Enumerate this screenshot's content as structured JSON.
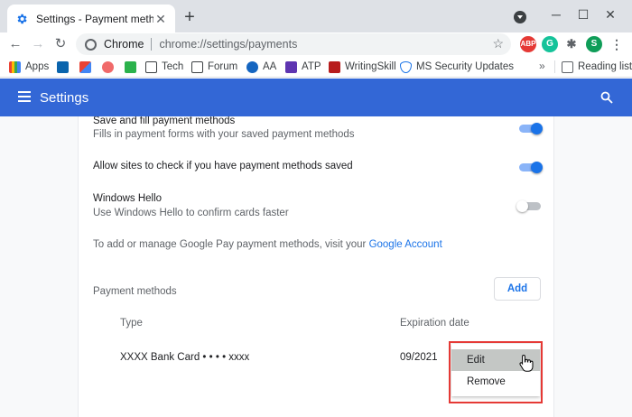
{
  "tab": {
    "title": "Settings - Payment methods",
    "close": "✕"
  },
  "window": {
    "new_tab": "+",
    "minimize": "─",
    "maximize": "☐",
    "close": "✕"
  },
  "toolbar": {
    "site_label": "Chrome",
    "url": "chrome://settings/payments",
    "extensions": [
      {
        "label": "ABP",
        "color": "#e53935"
      },
      {
        "label": "G",
        "color": "#15c39a"
      },
      {
        "label": "S",
        "color": "#0f9d58"
      }
    ]
  },
  "bookmarks": {
    "items": [
      "Apps",
      "",
      "",
      "",
      "",
      "Tech",
      "Forum",
      "AA",
      "ATP",
      "WritingSkill",
      "MS Security Updates"
    ],
    "chevron": "»",
    "reading_list": "Reading list"
  },
  "header": {
    "title": "Settings"
  },
  "settings": {
    "save_fill": {
      "title": "Save and fill payment methods",
      "description": "Fills in payment forms with your saved payment methods",
      "enabled": true
    },
    "allow_check": {
      "title": "Allow sites to check if you have payment methods saved",
      "enabled": true
    },
    "windows_hello": {
      "title": "Windows Hello",
      "description": "Use Windows Hello to confirm cards faster",
      "enabled": false
    },
    "google_pay": {
      "text": "To add or manage Google Pay payment methods, visit your ",
      "link": "Google Account"
    }
  },
  "payment_methods": {
    "heading": "Payment methods",
    "add_label": "Add",
    "columns": {
      "type": "Type",
      "expiration": "Expiration date"
    },
    "cards": [
      {
        "type": "XXXX Bank Card • • • • xxxx",
        "expiration": "09/2021"
      }
    ]
  },
  "context_menu": {
    "items": [
      "Edit",
      "Remove"
    ],
    "hovered": "Edit",
    "highlight_color": "#e53935"
  },
  "colors": {
    "accent": "#1a73e8",
    "header": "#3367d6"
  }
}
